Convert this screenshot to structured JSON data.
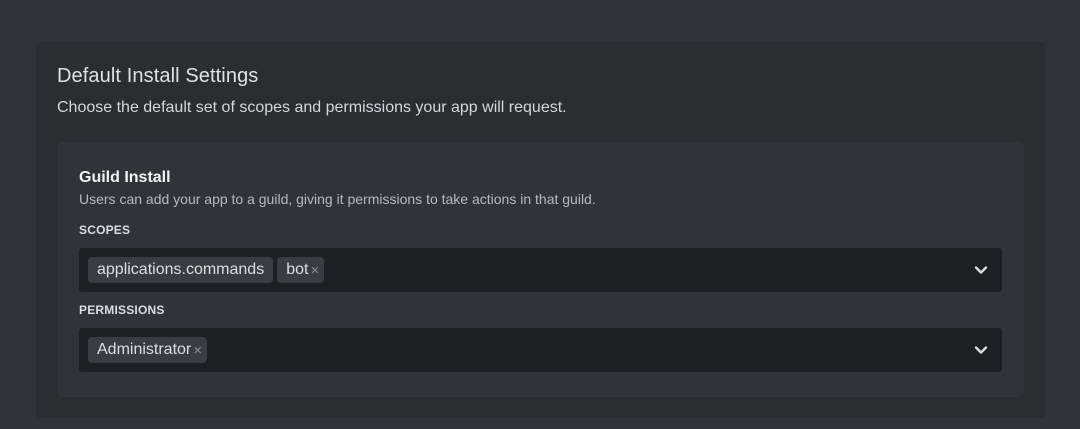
{
  "section": {
    "title": "Default Install Settings",
    "description": "Choose the default set of scopes and permissions your app will request."
  },
  "guild_install": {
    "title": "Guild Install",
    "description": "Users can add your app to a guild, giving it permissions to take actions in that guild.",
    "scopes": {
      "label": "SCOPES",
      "selected": [
        {
          "label": "applications.commands",
          "removable": false
        },
        {
          "label": "bot",
          "removable": true,
          "remove_icon": "×"
        }
      ],
      "dropdown_icon": "chevron-down-icon"
    },
    "permissions": {
      "label": "PERMISSIONS",
      "selected": [
        {
          "label": "Administrator",
          "removable": true,
          "remove_icon": "×"
        }
      ],
      "dropdown_icon": "chevron-down-icon"
    }
  },
  "colors": {
    "page_bg": "#313338",
    "card_bg": "#2b2d31",
    "inner_card_bg": "#313338",
    "input_bg": "#1e1f22",
    "tag_bg": "#3a3c42"
  }
}
